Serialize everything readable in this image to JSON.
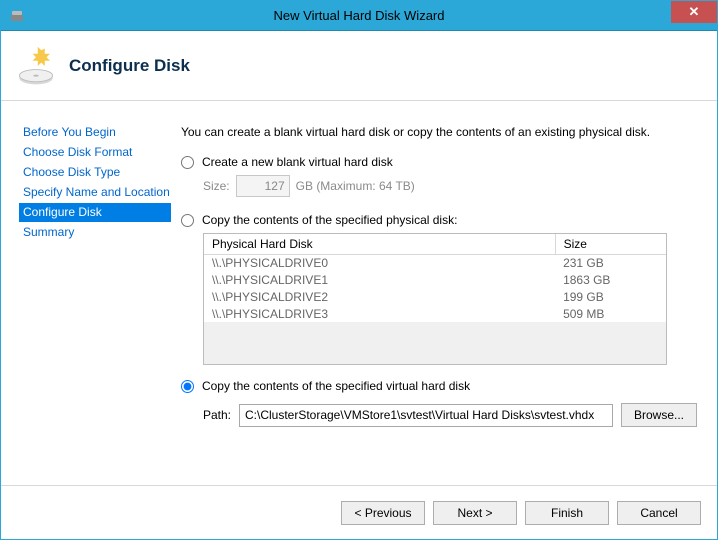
{
  "window": {
    "title": "New Virtual Hard Disk Wizard"
  },
  "header": {
    "page_title": "Configure Disk"
  },
  "sidebar": {
    "items": [
      {
        "label": "Before You Begin"
      },
      {
        "label": "Choose Disk Format"
      },
      {
        "label": "Choose Disk Type"
      },
      {
        "label": "Specify Name and Location"
      },
      {
        "label": "Configure Disk"
      },
      {
        "label": "Summary"
      }
    ],
    "selected_index": 4
  },
  "content": {
    "description": "You can create a blank virtual hard disk or copy the contents of an existing physical disk.",
    "option_blank": "Create a new blank virtual hard disk",
    "size_label": "Size:",
    "size_value": "127",
    "size_suffix": "GB (Maximum: 64 TB)",
    "option_physical": "Copy the contents of the specified physical disk:",
    "table": {
      "col_disk": "Physical Hard Disk",
      "col_size": "Size",
      "rows": [
        {
          "disk": "\\\\.\\PHYSICALDRIVE0",
          "size": "231 GB"
        },
        {
          "disk": "\\\\.\\PHYSICALDRIVE1",
          "size": "1863 GB"
        },
        {
          "disk": "\\\\.\\PHYSICALDRIVE2",
          "size": "199 GB"
        },
        {
          "disk": "\\\\.\\PHYSICALDRIVE3",
          "size": "509 MB"
        }
      ]
    },
    "option_virtual": "Copy the contents of the specified virtual hard disk",
    "path_label": "Path:",
    "path_value": "C:\\ClusterStorage\\VMStore1\\svtest\\Virtual Hard Disks\\svtest.vhdx",
    "browse_label": "Browse..."
  },
  "footer": {
    "previous": "< Previous",
    "next": "Next >",
    "finish": "Finish",
    "cancel": "Cancel"
  }
}
